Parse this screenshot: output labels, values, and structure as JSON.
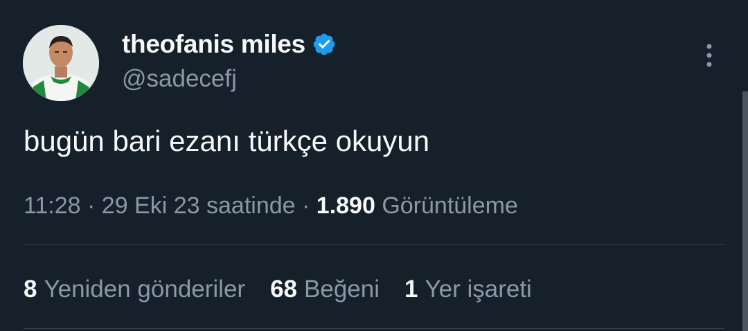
{
  "tweet": {
    "author": {
      "display_name": "theofanis miles",
      "handle": "@sadecefj",
      "verified": true,
      "verified_icon": "verified-badge-icon"
    },
    "text": "bugün bari ezanı türkçe okuyun",
    "meta": {
      "time": "11:28",
      "date": "29 Eki 23 saatinde",
      "separator": "·",
      "views_count": "1.890",
      "views_label": "Görüntüleme"
    },
    "stats": [
      {
        "count": "8",
        "label": "Yeniden gönderiler"
      },
      {
        "count": "68",
        "label": "Beğeni"
      },
      {
        "count": "1",
        "label": "Yer işareti"
      }
    ],
    "more_icon": "more-vertical-icon"
  },
  "colors": {
    "background": "#15202b",
    "primary_text": "#f7f9f9",
    "secondary_text": "#8b98a5",
    "verified_blue": "#1d9bf0",
    "divider": "#38444d"
  }
}
